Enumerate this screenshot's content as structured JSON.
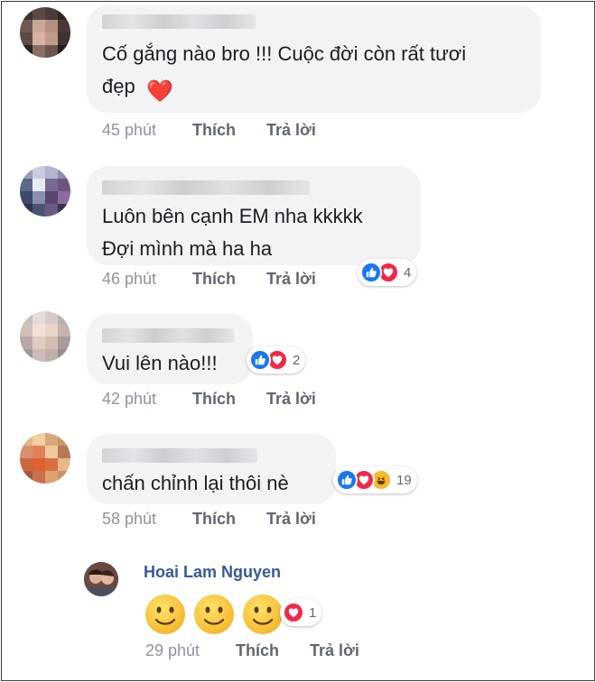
{
  "comments": [
    {
      "text": "Cố gắng nào bro !!! Cuộc đời còn rất tươi\nđẹp",
      "emoji": "❤️",
      "time": "45 phút",
      "like_label": "Thích",
      "reply_label": "Trả lời"
    },
    {
      "text": "Luôn bên cạnh EM nha kkkkk\nĐợi mình mà ha ha",
      "time": "46 phút",
      "like_label": "Thích",
      "reply_label": "Trả lời",
      "reaction_count": "4"
    },
    {
      "text": "Vui lên nào!!!",
      "time": "42 phút",
      "like_label": "Thích",
      "reply_label": "Trả lời",
      "reaction_count": "2"
    },
    {
      "text": "chấn chỉnh lại thôi nè",
      "time": "58 phút",
      "like_label": "Thích",
      "reply_label": "Trả lời",
      "reaction_count": "19"
    }
  ],
  "reply": {
    "author": "Hoai Lam Nguyen",
    "time": "29 phút",
    "like_label": "Thích",
    "reply_label": "Trả lời",
    "reaction_count": "1"
  },
  "colors": {
    "like": "#1877f2",
    "love": "#f0284a",
    "haha": "#f7b928",
    "bubble": "#f2f3f5",
    "meta": "#8d949e"
  }
}
